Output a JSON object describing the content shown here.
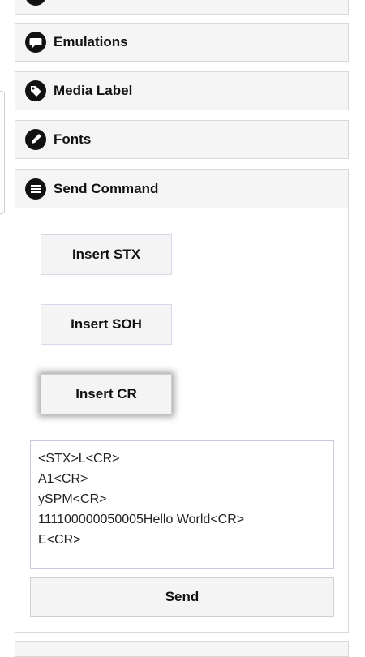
{
  "sections": [
    {
      "label": "Emulations",
      "icon": "chat-bubble-icon"
    },
    {
      "label": "Media Label",
      "icon": "tag-icon"
    },
    {
      "label": "Fonts",
      "icon": "pencil-icon"
    },
    {
      "label": "Send Command",
      "icon": "list-icon"
    }
  ],
  "send_command": {
    "insert_stx_label": "Insert STX",
    "insert_soh_label": "Insert SOH",
    "insert_cr_label": "Insert CR",
    "command_text": "<STX>L<CR>\nA1<CR>\nySPM<CR>\n111100000050005Hello World<CR>\nE<CR>",
    "send_label": "Send"
  }
}
